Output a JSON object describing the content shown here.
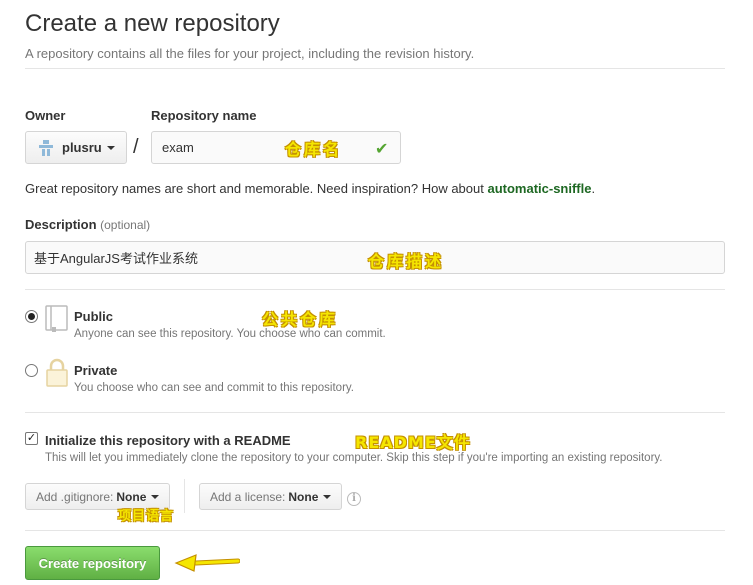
{
  "header": {
    "title": "Create a new repository",
    "subtitle": "A repository contains all the files for your project, including the revision history."
  },
  "owner": {
    "label": "Owner",
    "value": "plusru"
  },
  "repo": {
    "label": "Repository name",
    "separator": "/",
    "value": "exam",
    "valid_icon": "check-icon",
    "hint_prefix": "Great repository names are short and memorable. Need inspiration? How about ",
    "suggestion": "automatic-sniffle",
    "hint_suffix": "."
  },
  "description": {
    "label": "Description",
    "optional": "(optional)",
    "value": "基于AngularJS考试作业系统"
  },
  "visibility": {
    "selected": "Public",
    "public": {
      "title": "Public",
      "desc": "Anyone can see this repository. You choose who can commit."
    },
    "private": {
      "title": "Private",
      "desc": "You choose who can see and commit to this repository."
    }
  },
  "readme": {
    "checked": true,
    "title": "Initialize this repository with a README",
    "desc": "This will let you immediately clone the repository to your computer. Skip this step if you're importing an existing repository."
  },
  "gitignore": {
    "label": "Add .gitignore:",
    "value": "None"
  },
  "license": {
    "label": "Add a license:",
    "value": "None"
  },
  "submit": {
    "label": "Create repository"
  },
  "annotations": {
    "repo_name": "仓库名",
    "description": "仓库描述",
    "public": "公共仓库",
    "readme": "README文件",
    "gitignore": "项目语言"
  },
  "colors": {
    "accent_green": "#60b044",
    "suggestion_green": "#1e6823",
    "annotation_yellow": "#f5e600"
  }
}
